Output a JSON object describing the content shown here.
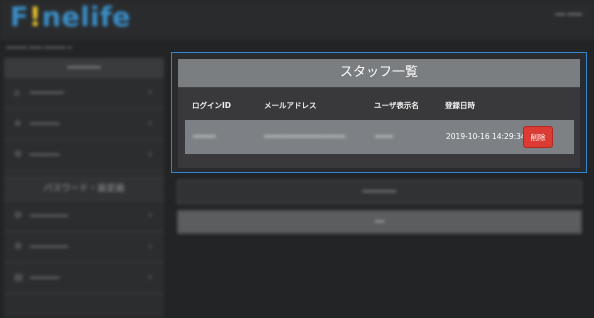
{
  "app": {
    "logo": {
      "part1": "F",
      "part2": "!",
      "part3": "nelife"
    },
    "top_right": "━━ ━━━",
    "breadcrumb": "━━━━━ ━━━ ━━━━━ ━"
  },
  "sidebar": {
    "header": "━━━━━━━",
    "items_top": [
      {
        "label": "━━━━━━━━",
        "icon": "home-icon"
      },
      {
        "label": "━━━━━━━",
        "icon": "list-icon"
      },
      {
        "label": "━━━━━━━",
        "icon": "gear-icon"
      }
    ],
    "section": "パスワード・設定画",
    "items_bottom": [
      {
        "label": "━━━━━━━━━",
        "icon": "settings-icon"
      },
      {
        "label": "━━━━━━━━━",
        "icon": "settings-icon"
      },
      {
        "label": "━━━━━━━",
        "icon": "document-icon"
      }
    ],
    "chevron": "›"
  },
  "main": {
    "button1": "━━━━━━━",
    "button2": "━━"
  },
  "modal": {
    "title": "スタッフ一覧",
    "columns": [
      "ログインID",
      "メールアドレス",
      "ユーザ表示名",
      "登録日時"
    ],
    "rows": [
      {
        "login_id": "━━━━━",
        "email": "━━━━━━━━━━━━━━━━━━",
        "display_name": "━━━━",
        "registered": "2019-10-16 14:29:34",
        "delete_label": "削除"
      }
    ]
  }
}
